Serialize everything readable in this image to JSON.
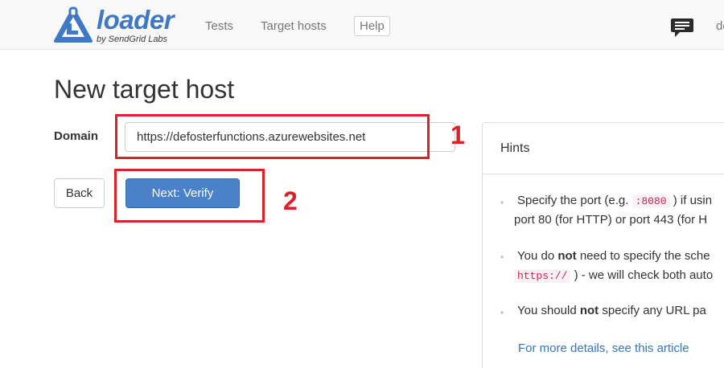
{
  "navbar": {
    "logo_text": "loader",
    "logo_subtext": "by SendGrid Labs",
    "links": [
      "Tests",
      "Target hosts"
    ],
    "help_label": "Help",
    "chat_icon": "chat-bubble-icon",
    "user_text": "de"
  },
  "page": {
    "title": "New target host",
    "domain_label": "Domain",
    "domain_value": "https://defosterfunctions.azurewebsites.net",
    "back_label": "Back",
    "next_label": "Next: Verify"
  },
  "annotations": {
    "color": "#d8232a",
    "labels": [
      "1",
      "2"
    ]
  },
  "hints": {
    "title": "Hints",
    "hint1": {
      "line1_pre": "Specify the port (e.g. ",
      "code": ":8080",
      "line1_post": " ) if usin",
      "line2": "port 80 (for HTTP) or port 443 (for H"
    },
    "hint2": {
      "line1_pre": "You do ",
      "bold": "not",
      "line1_post": " need to specify the sche",
      "code": "https://",
      "line2_post": " ) - we will check both auto"
    },
    "hint3": {
      "pre": "You should ",
      "bold": "not",
      "post": " specify any URL pa"
    },
    "link_text": "For more details, see this article"
  },
  "colors": {
    "primary_button": "#4a81c8",
    "brand": "#3f79c4",
    "link": "#3377bb",
    "code_text": "#c7254e"
  }
}
